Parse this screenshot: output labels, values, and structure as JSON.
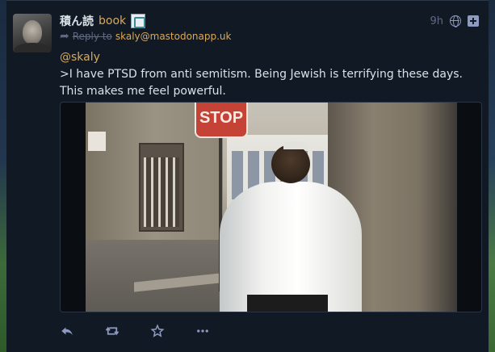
{
  "status": {
    "display_name": "積ん読",
    "handle": "book",
    "emoji_icon": "custom-emoji-icon",
    "reply_label": "Reply to",
    "reply_target": "skaly@mastodonapp.uk",
    "timestamp": "9h",
    "visibility_icon": "globe-icon",
    "expand_icon": "plus-square-icon",
    "mention": "@skaly",
    "body_text": ">I have PTSD from anti semitism. Being Jewish is terrifying these days. This makes me feel powerful.",
    "media": {
      "sign_text": "STOP"
    }
  },
  "actions": {
    "reply_icon": "reply-icon",
    "boost_icon": "boost-icon",
    "favourite_icon": "star-icon",
    "more_icon": "ellipsis-icon"
  },
  "colors": {
    "accent": "#d9a85b",
    "muted": "#606984",
    "text": "#d9e1e8",
    "background": "#111a24"
  }
}
